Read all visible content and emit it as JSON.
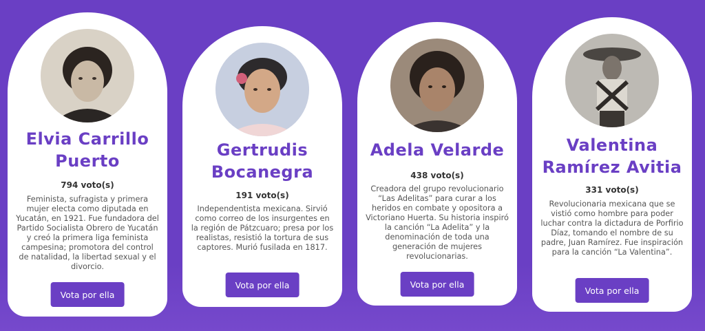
{
  "candidates": [
    {
      "name_line1": "Elvia Carrillo",
      "name_line2": "Puerto",
      "votes": "794 voto(s)",
      "description": "Feminista, sufragista y primera mujer electa como diputada en Yucatán, en 1921. Fue fundadora del Partido Socialista Obrero de Yucatán y creó la primera liga feminista campesina; promotora del control de natalidad, la libertad sexual y el divorcio.",
      "button_label": "Vota por ella"
    },
    {
      "name_line1": "Gertrudis",
      "name_line2": "Bocanegra",
      "votes": "191 voto(s)",
      "description": "Independentista mexicana. Sirvió como correo de los insurgentes en la región de Pátzcuaro; presa por los realistas, resistió la tortura de sus captores. Murió fusilada en 1817.",
      "button_label": "Vota por ella"
    },
    {
      "name_line1": "Adela Velarde",
      "name_line2": "",
      "votes": "438 voto(s)",
      "description": "Creadora del grupo revolucionario “Las Adelitas” para curar a los heridos en combate y opositora a Victoriano Huerta. Su historia inspiró la canción “La Adelita” y la denominación de toda una generación de mujeres revolucionarias.",
      "button_label": "Vota por ella"
    },
    {
      "name_line1": "Valentina",
      "name_line2": "Ramírez Avitia",
      "votes": "331 voto(s)",
      "description": "Revolucionaria mexicana que se vistió como hombre para poder luchar contra la dictadura de Porfirio Díaz, tomando el nombre de su padre, Juan Ramírez. Fue inspiración para la canción “La Valentina”.",
      "button_label": "Vota por ella"
    }
  ],
  "colors": {
    "background": "#6a3fc4",
    "accent": "#6a3fc4",
    "card": "#ffffff"
  }
}
